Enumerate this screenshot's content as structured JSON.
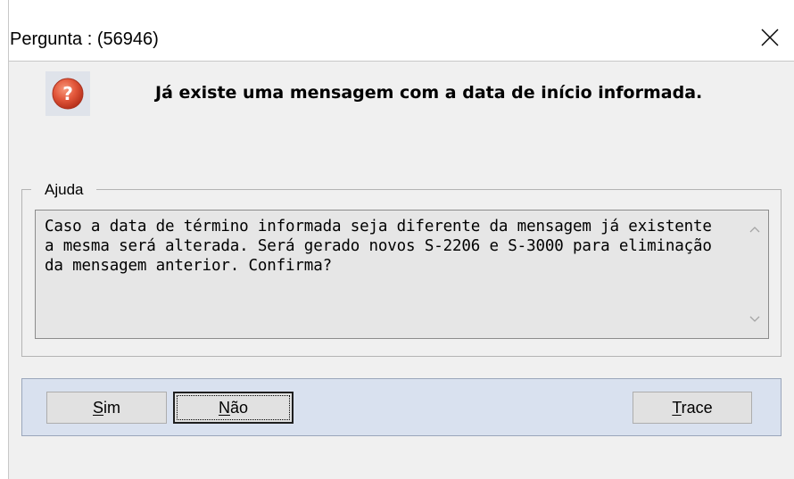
{
  "window": {
    "title": "Pergunta : (56946)",
    "close_glyph": "✕"
  },
  "message": {
    "icon": "question-icon",
    "text": "Já existe uma mensagem com a data de início informada."
  },
  "help": {
    "label": "Ajuda",
    "text": "Caso a data de término informada seja diferente da mensagem já existente a mesma será alterada. Será gerado novos S-2206 e S-3000 para eliminação da mensagem anterior. Confirma?",
    "scroll_up_glyph": "⌃",
    "scroll_down_glyph": "⌄"
  },
  "buttons": {
    "yes": {
      "accel": "S",
      "rest": "im",
      "label": "Sim"
    },
    "no": {
      "accel": "N",
      "rest": "ão",
      "label": "Não",
      "focused": true
    },
    "trace": {
      "accel": "T",
      "rest": "race",
      "label": "Trace"
    }
  },
  "colors": {
    "button_panel_bg": "#d9e1ef",
    "client_bg": "#f0f0f0",
    "help_box_bg": "#e6e6e6",
    "icon_red": "#d9452b"
  }
}
